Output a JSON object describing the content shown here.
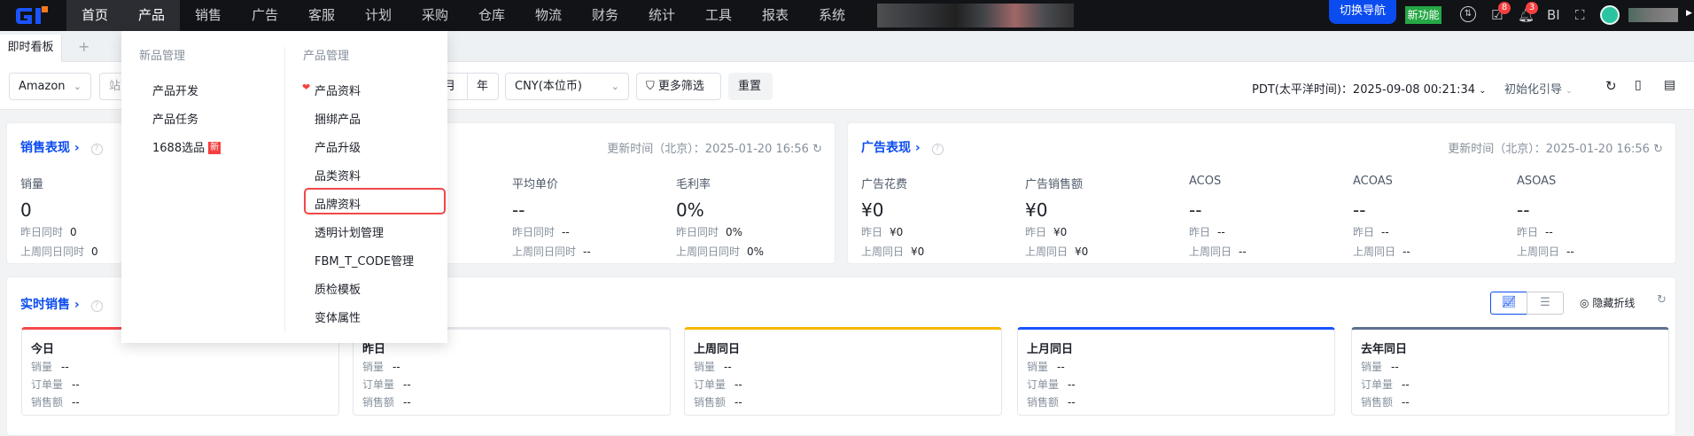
{
  "colors": {
    "accent": "#0b4cf0",
    "nav_bg": "#121316",
    "highlight": "#f04848",
    "new_feature": "#25a845"
  },
  "nav": {
    "items": [
      "首页",
      "产品",
      "销售",
      "广告",
      "客服",
      "计划",
      "采购",
      "仓库",
      "物流",
      "财务",
      "统计",
      "工具",
      "报表",
      "系统"
    ],
    "active": "产品",
    "switch_nav": "切换导航",
    "new_feature": "新功能",
    "task_badge": "8",
    "bell_badge": "3",
    "bi": "BI"
  },
  "tabs": {
    "items": [
      "即时看板"
    ],
    "add": "+"
  },
  "filters": {
    "platform": "Amazon",
    "site_placeholder": "站",
    "period_month": "月",
    "period_year": "年",
    "currency": "CNY(本位币)",
    "more_filters": "更多筛选",
    "reset": "重置",
    "timezone": "PDT(太平洋时间)：2025-09-08 00:21:34",
    "guide": "初始化引导"
  },
  "sales_card": {
    "title": "销售表现",
    "updated": "更新时间（北京）：2025-01-20 16:56",
    "metrics": [
      {
        "label": "销量",
        "value": "0",
        "sub1_label": "昨日同时",
        "sub1": "0",
        "sub2_label": "上周同日同时",
        "sub2": "0"
      },
      {
        "label": "平均单价",
        "value": "--",
        "sub1_label": "昨日同时",
        "sub1": "--",
        "sub2_label": "上周同日同时",
        "sub2": "--"
      },
      {
        "label": "毛利率",
        "value": "0%",
        "sub1_label": "昨日同时",
        "sub1": "0%",
        "sub2_label": "上周同日同时",
        "sub2": "0%"
      }
    ]
  },
  "ad_card": {
    "title": "广告表现",
    "updated": "更新时间（北京）：2025-01-20 16:56",
    "metrics": [
      {
        "label": "广告花费",
        "value": "¥0",
        "sub1_label": "昨日",
        "sub1": "¥0",
        "sub2_label": "上周同日",
        "sub2": "¥0"
      },
      {
        "label": "广告销售额",
        "value": "¥0",
        "sub1_label": "昨日",
        "sub1": "¥0",
        "sub2_label": "上周同日",
        "sub2": "¥0"
      },
      {
        "label": "ACOS",
        "value": "--",
        "sub1_label": "昨日",
        "sub1": "--",
        "sub2_label": "上周同日",
        "sub2": "--"
      },
      {
        "label": "ACOAS",
        "value": "--",
        "sub1_label": "昨日",
        "sub1": "--",
        "sub2_label": "上周同日",
        "sub2": "--"
      },
      {
        "label": "ASOAS",
        "value": "--",
        "sub1_label": "昨日",
        "sub1": "--",
        "sub2_label": "上周同日",
        "sub2": "--"
      }
    ]
  },
  "realtime": {
    "title": "实时销售",
    "hide_line": "隐藏折线",
    "row_labels": [
      "销量",
      "订单量",
      "销售额"
    ],
    "cards": [
      {
        "title": "今日",
        "color": "#f5484a",
        "values": [
          "--",
          "--",
          "--"
        ]
      },
      {
        "title": "昨日",
        "color": "#e5e6eb",
        "values": [
          "--",
          "--",
          "--"
        ]
      },
      {
        "title": "上周同日",
        "color": "#f5b800",
        "values": [
          "--",
          "--",
          "--"
        ]
      },
      {
        "title": "上月同日",
        "color": "#1a53ff",
        "values": [
          "--",
          "--",
          "--"
        ]
      },
      {
        "title": "去年同日",
        "color": "#5e7090",
        "values": [
          "--",
          "--",
          "--"
        ]
      }
    ]
  },
  "dropdown": {
    "left_header": "新品管理",
    "left_items": [
      "产品开发",
      "产品任务",
      "1688选品"
    ],
    "new_tag": "新",
    "right_header": "产品管理",
    "right_items": [
      "产品资料",
      "捆绑产品",
      "产品升级",
      "品类资料",
      "品牌资料",
      "透明计划管理",
      "FBM_T_CODE管理",
      "质检模板",
      "变体属性"
    ],
    "highlighted": "品牌资料"
  }
}
